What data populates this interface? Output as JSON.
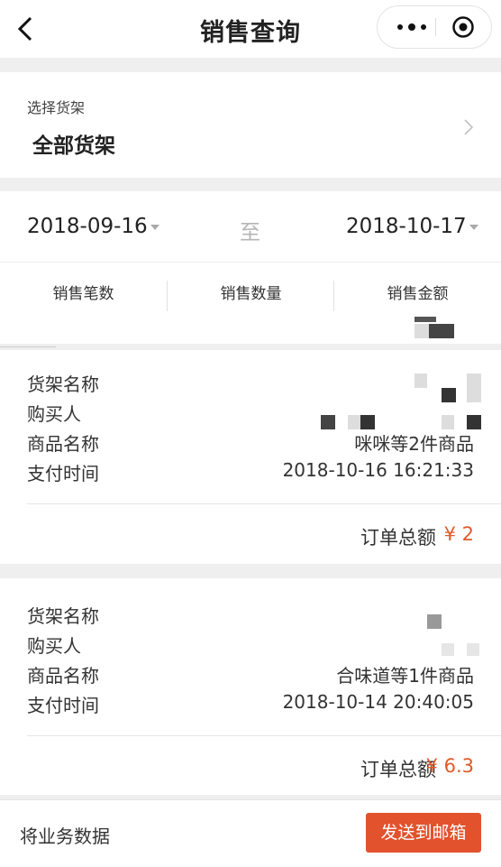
{
  "nav": {
    "title": "销售查询"
  },
  "shelf": {
    "label": "选择货架",
    "value": "全部货架"
  },
  "date_range": {
    "start": "2018-09-16",
    "to": "至",
    "end": "2018-10-17"
  },
  "stats": {
    "count_label": "销售笔数",
    "quantity_label": "销售数量",
    "amount_label": "销售金额"
  },
  "orders": [
    {
      "shelf_name_label": "货架名称",
      "buyer_label": "购买人",
      "product_label": "商品名称",
      "product_value": "咪咪等2件商品",
      "time_label": "支付时间",
      "time_value": "2018-10-16 16:21:33",
      "total_label": "订单总额",
      "total_value": "¥ 2"
    },
    {
      "shelf_name_label": "货架名称",
      "buyer_label": "购买人",
      "product_label": "商品名称",
      "product_value": "合味道等1件商品",
      "time_label": "支付时间",
      "time_value": "2018-10-14 20:40:05",
      "total_label": "订单总额",
      "total_value": "¥ 6.3"
    }
  ],
  "footer": {
    "label": "将业务数据",
    "button_label": "发送到邮箱"
  },
  "colors": {
    "accent": "#e2522c",
    "amount": "#e05a2a",
    "background": "#efefef"
  },
  "icons": [
    "back-chevron-icon",
    "more-dots-icon",
    "close-target-icon",
    "chevron-right-icon",
    "dropdown-caret-icon"
  ]
}
